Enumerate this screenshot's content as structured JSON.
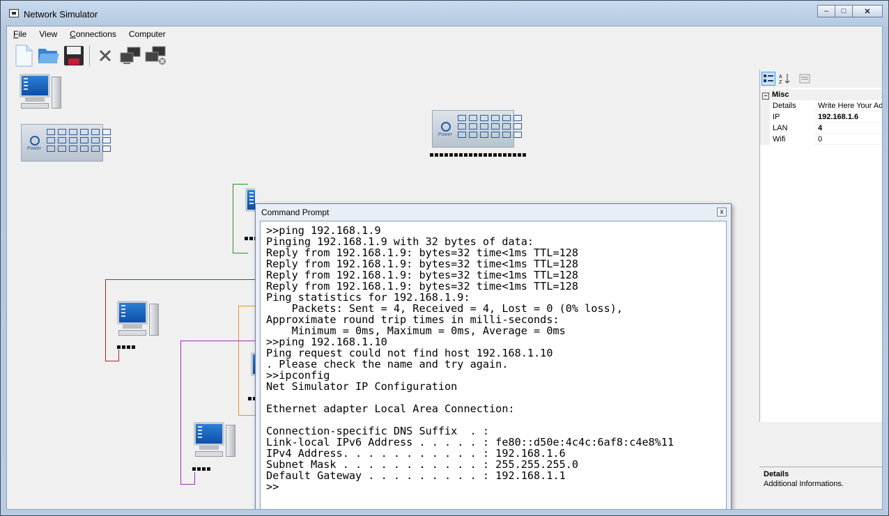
{
  "window": {
    "title": "Network Simulator",
    "minimize": "–",
    "maximize": "□",
    "close": "✕"
  },
  "menu": [
    {
      "label": "File",
      "u": "F",
      "rest": "ile"
    },
    {
      "label": "View",
      "u": "",
      "rest": "View"
    },
    {
      "label": "Connections",
      "u": "C",
      "rest": "onnections"
    },
    {
      "label": "Computer",
      "u": "",
      "rest": "Computer"
    }
  ],
  "toolbar": {
    "icons": [
      "new-document-icon",
      "open-folder-icon",
      "save-disk-icon",
      "delete-x-icon",
      "connect-computers-icon",
      "disconnect-computers-icon"
    ]
  },
  "switch_label": "Power",
  "cmd": {
    "title": "Command Prompt",
    "close": "x",
    "lines": [
      ">>ping 192.168.1.9",
      "Pinging 192.168.1.9 with 32 bytes of data:",
      "Reply from 192.168.1.9: bytes=32 time<1ms TTL=128",
      "Reply from 192.168.1.9: bytes=32 time<1ms TTL=128",
      "Reply from 192.168.1.9: bytes=32 time<1ms TTL=128",
      "Reply from 192.168.1.9: bytes=32 time<1ms TTL=128",
      "Ping statistics for 192.168.1.9:",
      "    Packets: Sent = 4, Received = 4, Lost = 0 (0% loss),",
      "Approximate round trip times in milli-seconds:",
      "    Minimum = 0ms, Maximum = 0ms, Average = 0ms",
      ">>ping 192.168.1.10",
      "Ping request could not find host 192.168.1.10",
      ". Please check the name and try again.",
      ">>ipconfig",
      "Net Simulator IP Configuration",
      "",
      "Ethernet adapter Local Area Connection:",
      "",
      "Connection-specific DNS Suffix  . :",
      "Link-local IPv6 Address . . . . . : fe80::d50e:4c4c:6af8:c4e8%11",
      "IPv4 Address. . . . . . . . . . . : 192.168.1.6",
      "Subnet Mask . . . . . . . . . . . : 255.255.255.0",
      "Default Gateway . . . . . . . . . : 192.168.1.1",
      ">>"
    ]
  },
  "properties": {
    "category": "Misc",
    "collapse": "−",
    "rows": [
      {
        "key": "Details",
        "value": "Write Here Your Ad",
        "bold": false
      },
      {
        "key": "IP",
        "value": "192.168.1.6",
        "bold": true
      },
      {
        "key": "LAN",
        "value": "4",
        "bold": true
      },
      {
        "key": "Wifi",
        "value": "0",
        "bold": false
      }
    ],
    "description_title": "Details",
    "description_text": "Additional Informations."
  },
  "colors": {
    "wire_green": "#2e8b2e",
    "wire_red": "#b22222",
    "wire_orange": "#e8902a",
    "wire_purple": "#9b30b0"
  }
}
